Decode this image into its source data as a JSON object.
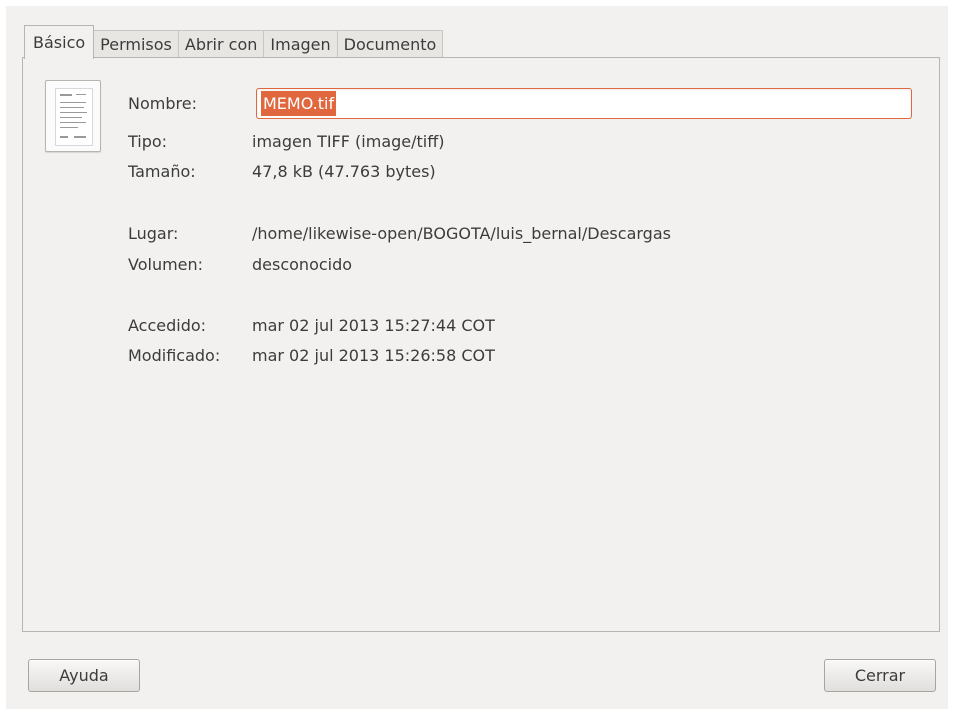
{
  "tabs": [
    {
      "label": "Básico",
      "active": true
    },
    {
      "label": "Permisos",
      "active": false
    },
    {
      "label": "Abrir con",
      "active": false
    },
    {
      "label": "Imagen",
      "active": false
    },
    {
      "label": "Documento",
      "active": false
    }
  ],
  "file": {
    "icon": "tiff-document-icon",
    "name_label": "Nombre:",
    "name_value": "MEMO.tif",
    "type_label": "Tipo:",
    "type_value": "imagen TIFF (image/tiff)",
    "size_label": "Tamaño:",
    "size_value": "47,8 kB (47.763 bytes)",
    "location_label": "Lugar:",
    "location_value": "/home/likewise-open/BOGOTA/luis_bernal/Descargas",
    "volume_label": "Volumen:",
    "volume_value": "desconocido",
    "accessed_label": "Accedido:",
    "accessed_value": "mar 02 jul 2013 15:27:44 COT",
    "modified_label": "Modificado:",
    "modified_value": "mar 02 jul 2013 15:26:58 COT"
  },
  "buttons": {
    "help": "Ayuda",
    "close": "Cerrar"
  },
  "colors": {
    "accent": "#e0673e",
    "window_bg": "#f2f1f0",
    "text": "#3c3c3c"
  }
}
